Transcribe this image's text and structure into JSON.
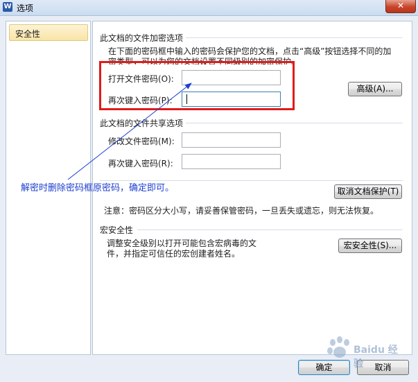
{
  "window": {
    "title": "选项",
    "app_icon_letter": "W",
    "close_glyph": "✕"
  },
  "sidebar": {
    "items": [
      {
        "label": "安全性"
      }
    ]
  },
  "encryption": {
    "section_title": "此文档的文件加密选项",
    "description_line1": "在下面的密码框中输入的密码会保护您的文档，点击“高级”按钮选择不同的加",
    "description_line2": "密类型，可以为您的文档设置不同级别的加密保护。",
    "open_password_label": "打开文件密码(O):",
    "open_password_value": "",
    "reenter_label": "再次键入密码(P):",
    "reenter_value": "",
    "advanced_button": "高级(A)..."
  },
  "sharing": {
    "section_title": "此文档的文件共享选项",
    "modify_password_label": "修改文件密码(M):",
    "modify_password_value": "",
    "reenter_label": "再次键入密码(R):",
    "reenter_value": "",
    "cancel_protect_button": "取消文档保护(T)"
  },
  "note": "注意：密码区分大小写，请妥善保管密码，一旦丢失或遗忘，则无法恢复。",
  "macro": {
    "section_title": "宏安全性",
    "description_line1": "调整安全级别以打开可能包含宏病毒的文",
    "description_line2": "件，并指定可信任的宏创建者姓名。",
    "button": "宏安全性(S)..."
  },
  "footer": {
    "ok_button": "确定",
    "cancel_button": "取消"
  },
  "annotation": {
    "text": "解密时删除密码框原密码，确定即可。",
    "highlight_color": "#e01b1b",
    "text_color": "#1d3fd0"
  },
  "watermark": {
    "text": "Baidu 经验"
  }
}
